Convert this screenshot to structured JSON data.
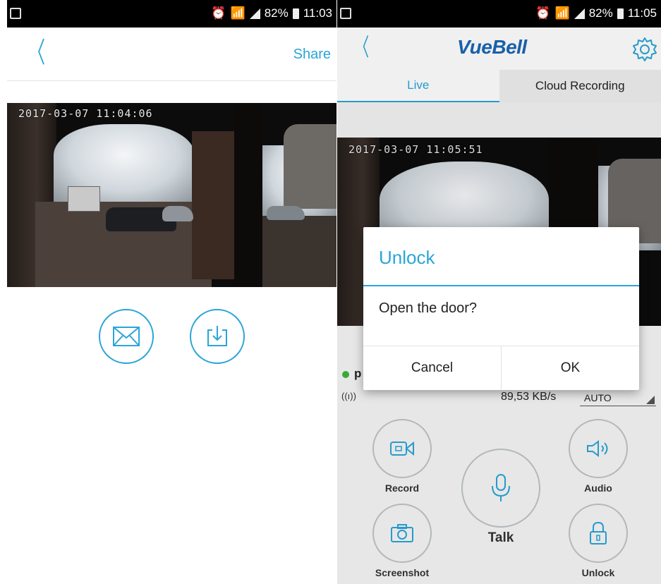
{
  "left_screen": {
    "status_bar": {
      "battery": "82%",
      "time": "11:03"
    },
    "header": {
      "back_icon": "chevron-left-icon",
      "share_label": "Share"
    },
    "video": {
      "timestamp": "2017-03-07 11:04:06"
    },
    "actions": [
      {
        "icon": "envelope-icon"
      },
      {
        "icon": "download-icon"
      }
    ]
  },
  "right_screen": {
    "status_bar": {
      "battery": "82%",
      "time": "11:05"
    },
    "header": {
      "back_icon": "chevron-left-icon",
      "brand": "VueBell",
      "settings_icon": "gear-icon"
    },
    "tabs": [
      {
        "label": "Live"
      },
      {
        "label": "Cloud Recording"
      }
    ],
    "video": {
      "timestamp": "2017-03-07 11:05:51"
    },
    "device": {
      "name_fragment": "p",
      "rate": "89,53 KB/s",
      "quality": "AUTO"
    },
    "controls": {
      "record": "Record",
      "audio": "Audio",
      "talk": "Talk",
      "screenshot": "Screenshot",
      "unlock": "Unlock"
    },
    "dialog": {
      "title": "Unlock",
      "message": "Open the door?",
      "cancel": "Cancel",
      "ok": "OK"
    }
  },
  "colors": {
    "accent": "#2aa5d8",
    "brand": "#1a67b5",
    "online": "#3bb53b"
  }
}
